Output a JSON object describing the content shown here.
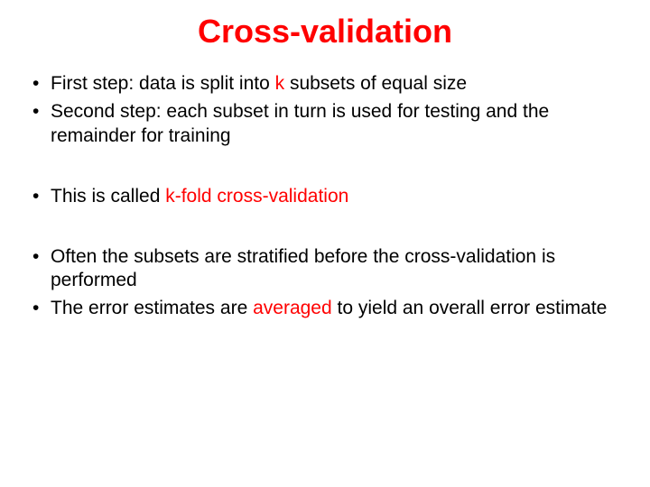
{
  "title": "Cross-validation",
  "bullets": {
    "b1_prefix": "First step: data is split into ",
    "b1_em": "k",
    "b1_suffix": " subsets of equal size",
    "b2": "Second step: each subset in turn is used for testing and the remainder for training",
    "b3_prefix": "This is called ",
    "b3_em": "k-fold cross-validation",
    "b4": "Often the subsets are stratified before the cross-validation is performed",
    "b5_prefix": "The error estimates are ",
    "b5_em": "averaged",
    "b5_suffix": " to yield an overall error estimate"
  }
}
